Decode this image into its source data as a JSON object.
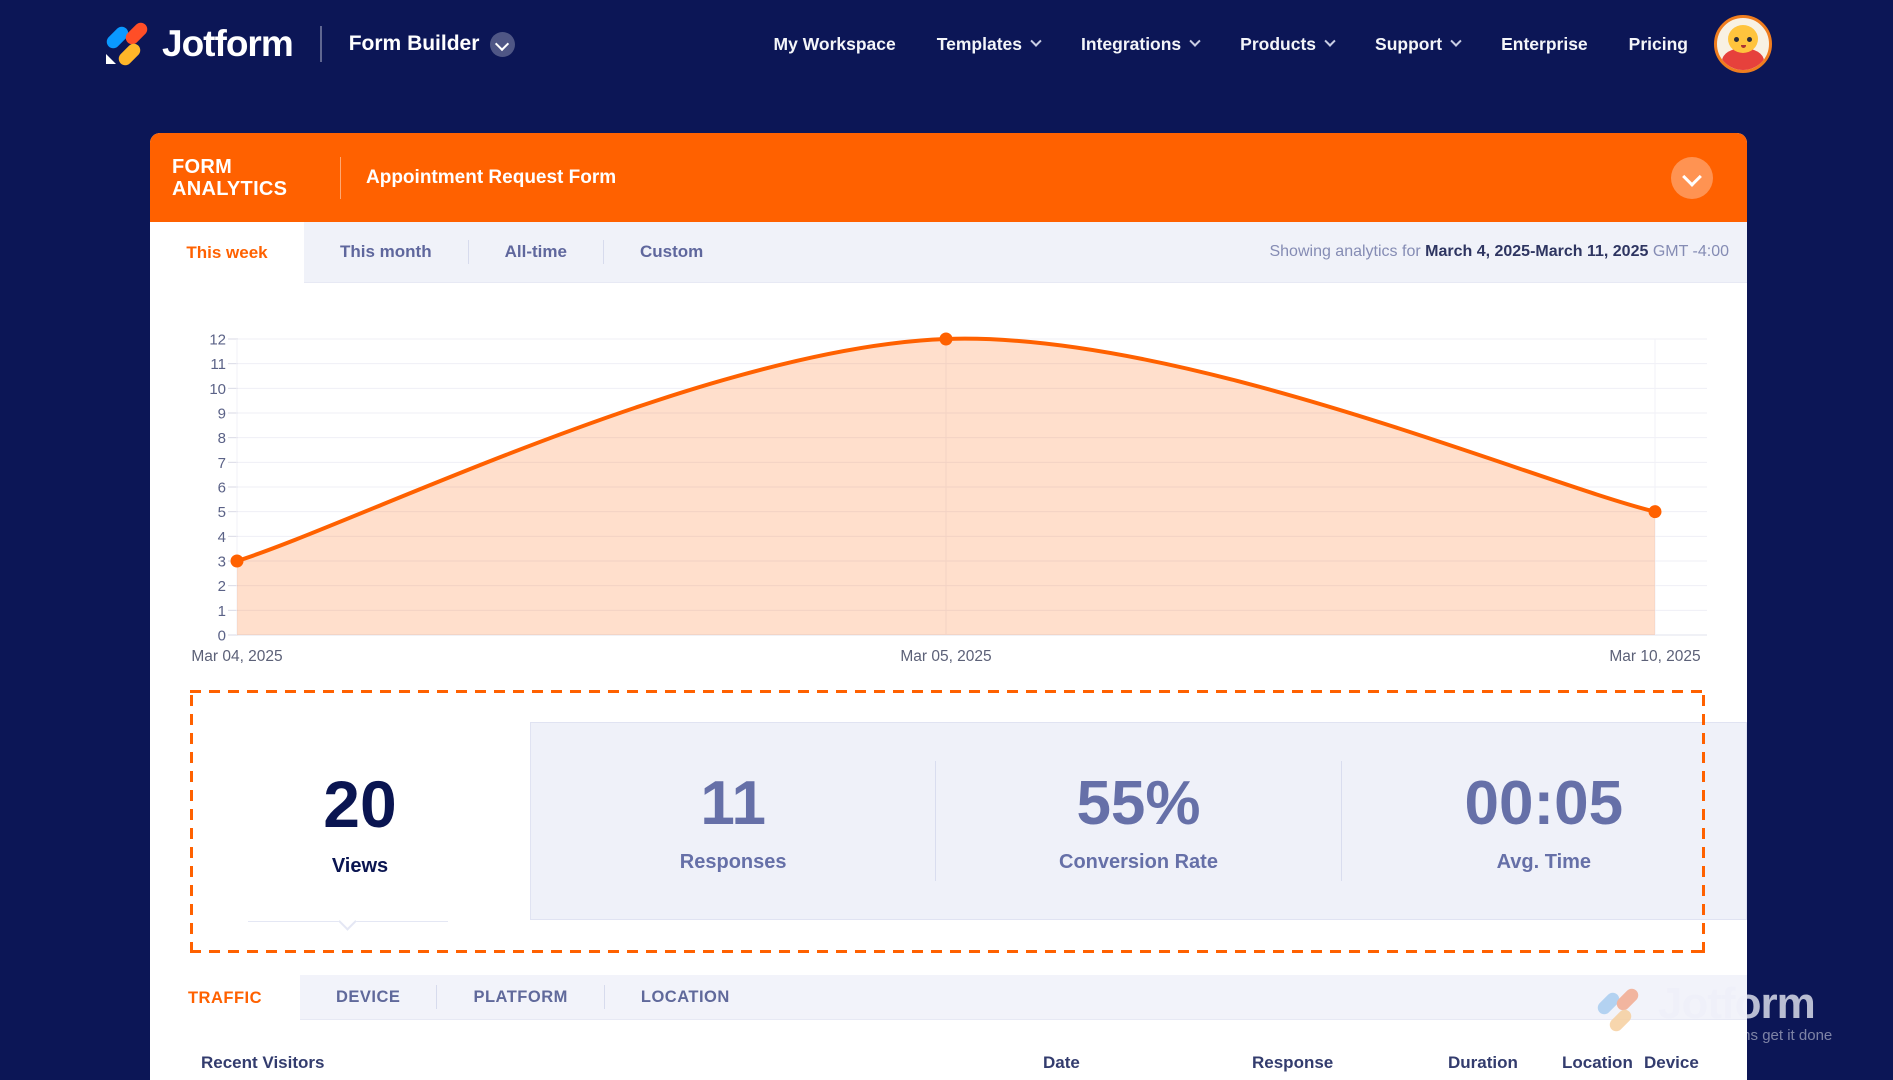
{
  "nav": {
    "brand": "Jotform",
    "product_label": "Form Builder",
    "items": [
      {
        "label": "My Workspace",
        "dropdown": false
      },
      {
        "label": "Templates",
        "dropdown": true
      },
      {
        "label": "Integrations",
        "dropdown": true
      },
      {
        "label": "Products",
        "dropdown": true
      },
      {
        "label": "Support",
        "dropdown": true
      },
      {
        "label": "Enterprise",
        "dropdown": false
      },
      {
        "label": "Pricing",
        "dropdown": false
      }
    ]
  },
  "analytics_header": {
    "kicker": "FORM ANALYTICS",
    "form_title": "Appointment Request Form"
  },
  "range_tabs": [
    {
      "label": "This week",
      "active": true
    },
    {
      "label": "This month",
      "active": false
    },
    {
      "label": "All-time",
      "active": false
    },
    {
      "label": "Custom",
      "active": false
    }
  ],
  "showing": {
    "prefix": "Showing analytics for",
    "date_range": "March 4, 2025-March 11, 2025",
    "timezone": "GMT -4:00"
  },
  "chart_data": {
    "type": "area",
    "x": [
      "Mar 04, 2025",
      "Mar 05, 2025",
      "Mar 10, 2025"
    ],
    "series": [
      {
        "name": "Views",
        "values": [
          3,
          12,
          5
        ]
      }
    ],
    "ylim": [
      0,
      12
    ],
    "ytick_step": 1,
    "grid": true,
    "legend": "none",
    "line_color": "#FF6100",
    "fill_color": "rgba(255,97,0,0.2)"
  },
  "stats": [
    {
      "value": "20",
      "label": "Views",
      "active": true
    },
    {
      "value": "11",
      "label": "Responses",
      "active": false
    },
    {
      "value": "55%",
      "label": "Conversion Rate",
      "active": false
    },
    {
      "value": "00:05",
      "label": "Avg. Time",
      "active": false
    }
  ],
  "detail_tabs": [
    {
      "label": "TRAFFIC",
      "active": true
    },
    {
      "label": "DEVICE",
      "active": false
    },
    {
      "label": "PLATFORM",
      "active": false
    },
    {
      "label": "LOCATION",
      "active": false
    }
  ],
  "visitors_table": {
    "title": "Recent Visitors",
    "columns": [
      "Date",
      "Response",
      "Duration",
      "Location",
      "Device"
    ]
  },
  "watermark": {
    "brand": "Jotform",
    "tagline": "Powerful forms get it done"
  },
  "colors": {
    "accent_orange": "#FF6100",
    "navy": "#0C1656",
    "lavender": "#F0F2F9",
    "muted_purple": "#6670A8"
  }
}
